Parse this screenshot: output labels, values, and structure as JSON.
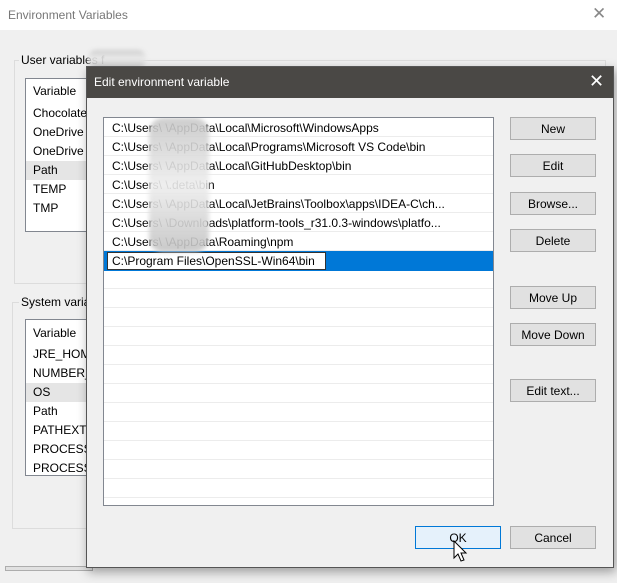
{
  "outer": {
    "title": "Environment Variables",
    "close": "✕",
    "user_group": "User variables f",
    "user_list": [
      "Variable",
      "Chocolate",
      "OneDrive",
      "OneDrive",
      "Path",
      "TEMP",
      "TMP"
    ],
    "system_group": "System varia",
    "system_list": [
      "Variable",
      "JRE_HOM",
      "NUMBER_",
      "OS",
      "Path",
      "PATHEXT",
      "PROCESS",
      "PROCESS"
    ]
  },
  "dialog": {
    "title": "Edit environment variable",
    "close": "✕",
    "entries": [
      "C:\\Users\\        \\AppData\\Local\\Microsoft\\WindowsApps",
      "C:\\Users\\        \\AppData\\Local\\Programs\\Microsoft VS Code\\bin",
      "C:\\Users\\        \\AppData\\Local\\GitHubDesktop\\bin",
      "C:\\Users\\        \\.deta\\bin",
      "C:\\Users\\        \\AppData\\Local\\JetBrains\\Toolbox\\apps\\IDEA-C\\ch...",
      "C:\\Users\\        \\Downloads\\platform-tools_r31.0.3-windows\\platfo...",
      "C:\\Users\\        \\AppData\\Roaming\\npm"
    ],
    "editing_value": "C:\\Program Files\\OpenSSL-Win64\\bin",
    "buttons": {
      "new": "New",
      "edit": "Edit",
      "browse": "Browse...",
      "delete": "Delete",
      "move_up": "Move Up",
      "move_down": "Move Down",
      "edit_text": "Edit text...",
      "ok": "OK",
      "cancel": "Cancel"
    },
    "accent": "#0078d7"
  }
}
